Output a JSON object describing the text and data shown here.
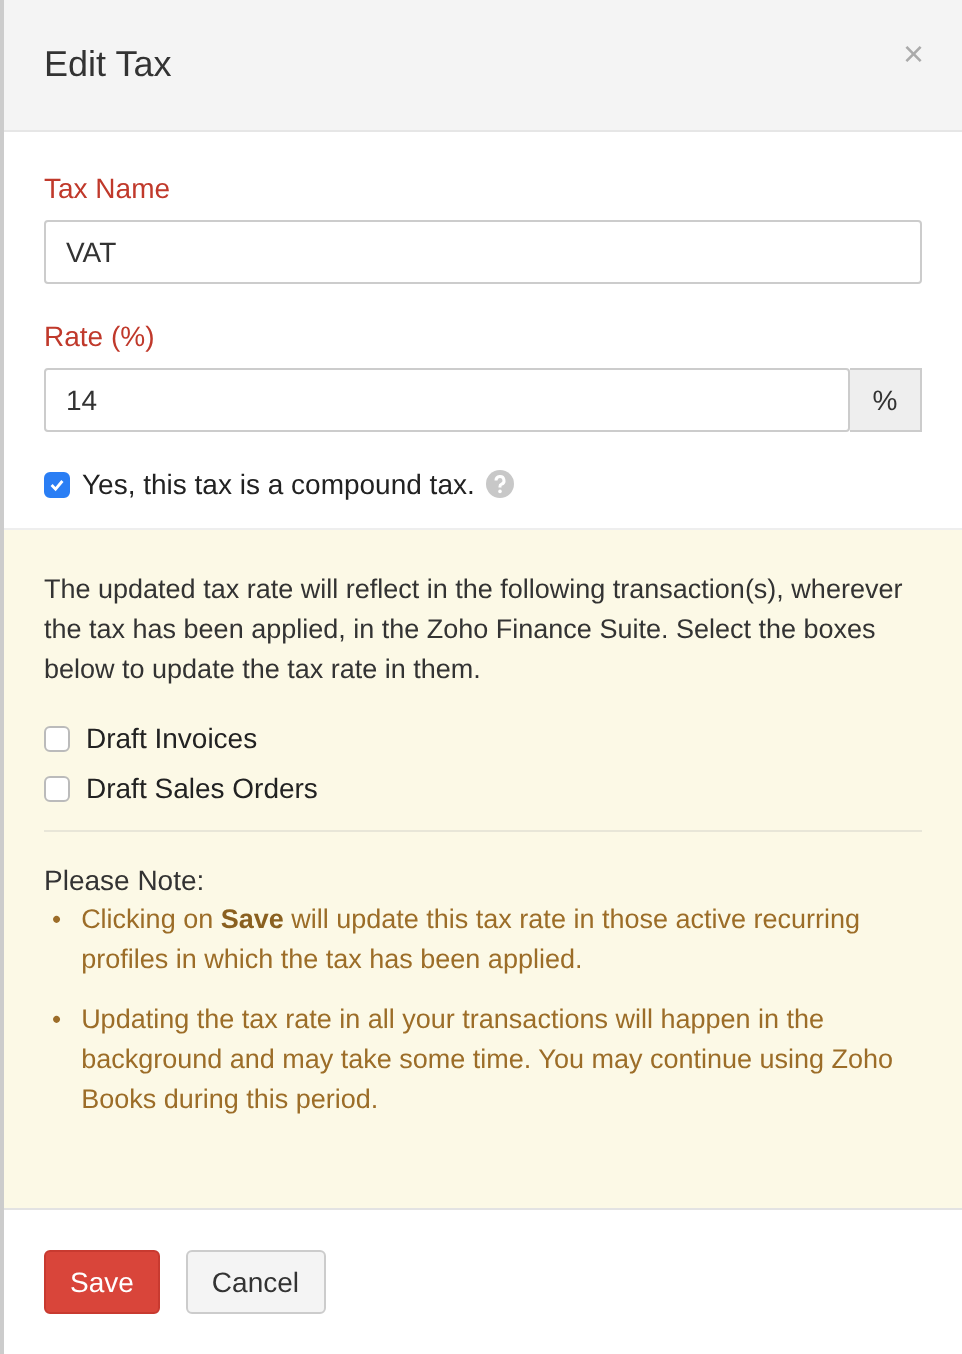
{
  "dialog": {
    "title": "Edit Tax",
    "close": "×"
  },
  "fields": [
    {
      "label": "Tax Name",
      "value": "VAT"
    },
    {
      "label": "Rate (%)",
      "value": "14",
      "addon": "%"
    }
  ],
  "compound": {
    "label": "Yes, this tax is a compound tax.",
    "checked": true
  },
  "notice": {
    "text": "The updated tax rate will reflect in the following transaction(s), wherever the tax has been applied, in the Zoho Finance Suite. Select the boxes below to update the tax rate in them.",
    "options": [
      {
        "label": "Draft Invoices",
        "checked": false
      },
      {
        "label": "Draft Sales Orders",
        "checked": false
      }
    ],
    "note_title": "Please Note:",
    "notes": [
      {
        "bullet": "•",
        "text": "Clicking on **Save** will update this tax rate in those active recurring profiles in which the tax has been applied."
      },
      {
        "bullet": "•",
        "text": "Updating the tax rate in all your transactions will happen in the background and may take some time. You may continue using Zoho Books during this period."
      }
    ]
  },
  "buttons": [
    {
      "label": "Save",
      "kind": "primary"
    },
    {
      "label": "Cancel",
      "kind": "secondary"
    }
  ]
}
